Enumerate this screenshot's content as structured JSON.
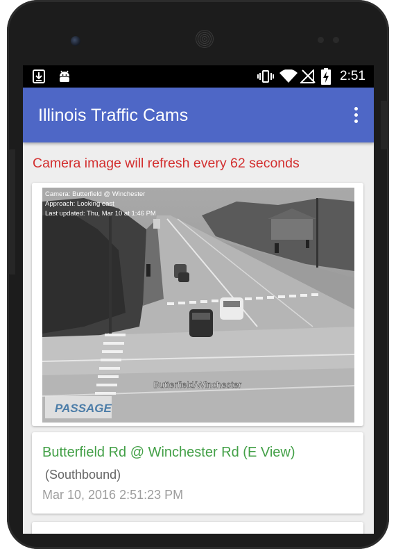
{
  "status_bar": {
    "time": "2:51",
    "left_icons": [
      "download-icon",
      "android-icon"
    ],
    "right_icons": [
      "vibrate-icon",
      "wifi-icon",
      "signal-icon",
      "battery-charging-icon"
    ]
  },
  "app_bar": {
    "title": "Illinois Traffic Cams",
    "menu_icon": "overflow-menu-icon",
    "color": "#4e67c6"
  },
  "refresh_notice": {
    "text": "Camera image will refresh every 62 seconds",
    "color": "#d32f2f"
  },
  "camera_image": {
    "overlay_lines": [
      "Camera: Butterfield @ Winchester",
      "Approach: Looking east",
      "Last updated: Thu, Mar 10 at 1:46 PM"
    ],
    "street_label": "Butterfield/Winchester",
    "watermark": "PASSAGE"
  },
  "camera_info": {
    "name": "Butterfield Rd @ Winchester Rd (E View)",
    "direction": "(Southbound)",
    "timestamp": "Mar 10, 2016 2:51:23 PM",
    "name_color": "#43a047"
  }
}
